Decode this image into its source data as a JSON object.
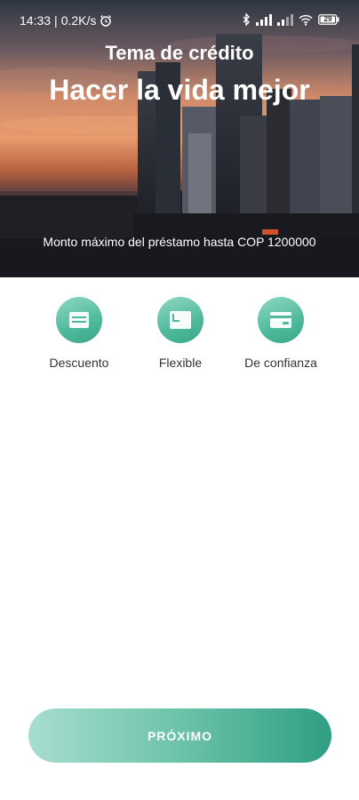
{
  "status_bar": {
    "time": "14:33",
    "separator": "|",
    "speed": "0.2K/s",
    "battery": "29"
  },
  "hero": {
    "subtitle": "Tema de crédito",
    "title": "Hacer la vida mejor",
    "max_amount": "Monto máximo del préstamo hasta COP 1200000"
  },
  "features": [
    {
      "label": "Descuento",
      "icon": "document-icon"
    },
    {
      "label": "Flexible",
      "icon": "window-icon"
    },
    {
      "label": "De confianza",
      "icon": "card-icon"
    }
  ],
  "next_button": {
    "label": "PRÓXIMO"
  },
  "colors": {
    "accent": "#4fb99c",
    "button_start": "#a7ddd0",
    "button_end": "#2f9e82"
  }
}
